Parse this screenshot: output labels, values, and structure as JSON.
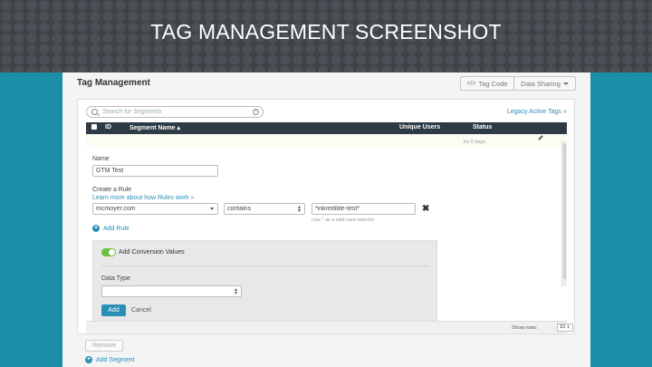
{
  "banner": {
    "title": "TAG MANAGEMENT SCREENSHOT"
  },
  "app": {
    "page_title": "Tag Management",
    "tag_code_button": "Tag Code",
    "data_sharing_button": "Data Sharing",
    "search": {
      "placeholder": "Search for Segments"
    },
    "legacy_link": "Legacy Active Tags »",
    "table": {
      "columns": [
        "ID",
        "Segment Name",
        "Unique Users",
        "Status"
      ],
      "partial_row_status_sub": "for 0 days"
    },
    "form": {
      "name_label": "Name",
      "name_value": "GTM Test",
      "create_rule_label": "Create a Rule",
      "learn_link": "Learn more about how Rules work »",
      "rule_field": "mcmoyer.com",
      "rule_operator": "contains",
      "rule_value": "*inkredible-test*",
      "wildcard_hint": "Use * as a wild card selector",
      "add_rule": "Add Rule",
      "conversion_toggle_label": "Add Conversion Values",
      "conversion_enabled": true,
      "data_type_label": "Data Type",
      "data_type_value": "",
      "add_button": "Add",
      "cancel_button": "Cancel"
    },
    "pagination": {
      "show_rows_label": "Show rows:",
      "rows_value": "10"
    },
    "remove_button": "Remove",
    "add_segment_button": "Add Segment"
  },
  "colors": {
    "accent": "#2a8fb7",
    "header_dark": "#2e3b44",
    "toggle_on": "#6bbf3a",
    "background_teal": "#1a8fa7"
  }
}
